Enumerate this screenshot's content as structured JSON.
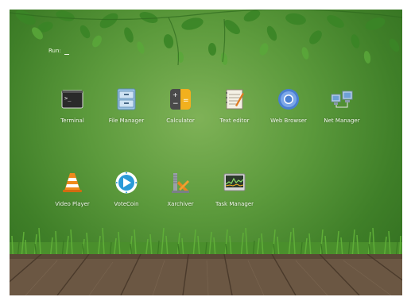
{
  "run": {
    "label": "Run:"
  },
  "apps": [
    {
      "id": "terminal",
      "label": "Terminal",
      "icon": "terminal-icon"
    },
    {
      "id": "file-manager",
      "label": "File Manager",
      "icon": "file-cabinet-icon"
    },
    {
      "id": "calculator",
      "label": "Calculator",
      "icon": "calculator-icon"
    },
    {
      "id": "text-editor",
      "label": "Text editor",
      "icon": "notepad-icon"
    },
    {
      "id": "web-browser",
      "label": "Web Browser",
      "icon": "chromium-icon"
    },
    {
      "id": "net-manager",
      "label": "Net Manager",
      "icon": "network-computers-icon"
    },
    {
      "id": "video-player",
      "label": "Video Player",
      "icon": "traffic-cone-icon"
    },
    {
      "id": "votecoin",
      "label": "VoteCoin",
      "icon": "votecoin-icon"
    },
    {
      "id": "xarchiver",
      "label": "Xarchiver",
      "icon": "archive-clamp-icon"
    },
    {
      "id": "task-manager",
      "label": "Task Manager",
      "icon": "system-monitor-icon"
    }
  ],
  "colors": {
    "background": "#5c9a3c",
    "leaves": "#3d8a28",
    "grass": "#4f9a2e",
    "floor": "#6e5a44",
    "label": "#f4f8ef"
  }
}
